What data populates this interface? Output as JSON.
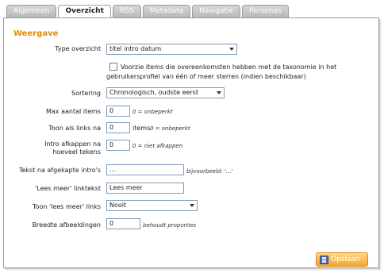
{
  "tabs": [
    {
      "label": "Algemeen"
    },
    {
      "label": "Overzicht"
    },
    {
      "label": "RSS"
    },
    {
      "label": "Metadata"
    },
    {
      "label": "Navigatie"
    },
    {
      "label": "Personas"
    }
  ],
  "section": {
    "title": "Weergave"
  },
  "fields": {
    "type_overzicht": {
      "label": "Type overzicht",
      "value": "titel intro datum"
    },
    "taxonomie": {
      "text": "Voorzie items die overeenkomsten hebben met de taxonomie in het gebruikersprofiel van één of meer sterren (indien beschikbaar)",
      "checked": false
    },
    "sortering": {
      "label": "Sortering",
      "value": "Chronologisch, oudste eerst"
    },
    "max_items": {
      "label": "Max aantal items",
      "value": "0",
      "hint": "0 = onbeperkt"
    },
    "links_na": {
      "label": "Toon als links na",
      "value": "0",
      "suffix": "items",
      "hint": "0 = onbeperkt"
    },
    "intro_afkappen": {
      "label": "Intro afkappen na hoeveel tekens",
      "value": "0",
      "hint": "0 = niet afkappen"
    },
    "tekst_na": {
      "label": "Tekst na afgekapte intro's",
      "value": "...",
      "hint": "bijvoorbeeld: '...'"
    },
    "lees_meer_tekst": {
      "label": "'Lees meer' linktekst",
      "value": "Lees meer"
    },
    "toon_lees_meer": {
      "label": "Toon 'lees meer' links",
      "value": "Nooit"
    },
    "breedte": {
      "label": "Breedte afbeeldingen",
      "value": "0",
      "hint": "behoudt proporties"
    }
  },
  "buttons": {
    "save": "Opslaan"
  },
  "colors": {
    "accent": "#e68a00",
    "button": "#f4a52a"
  }
}
